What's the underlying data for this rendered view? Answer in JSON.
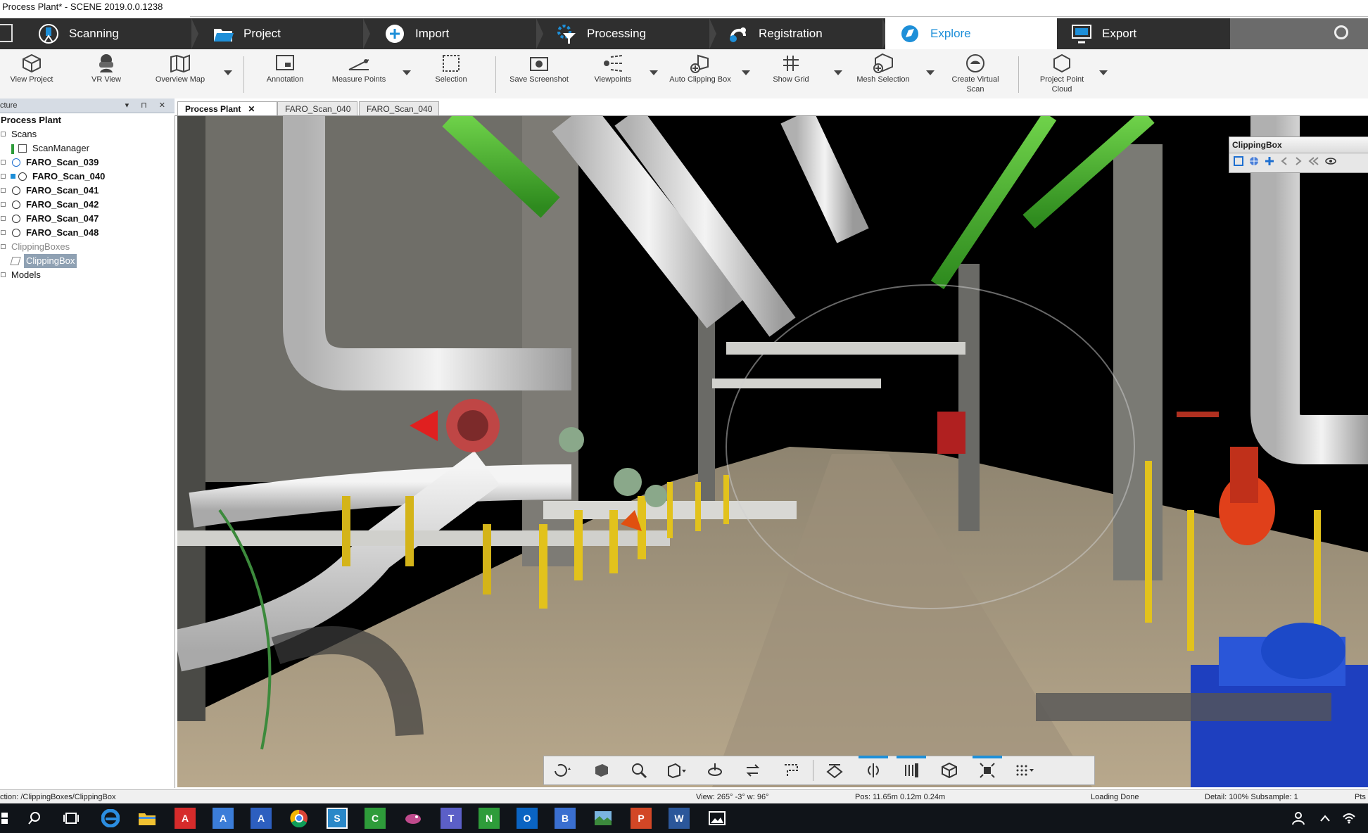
{
  "window": {
    "title": "Process Plant* - SCENE 2019.0.0.1238"
  },
  "main_tabs": [
    {
      "label": "Scanning",
      "icon": "scanner-icon"
    },
    {
      "label": "Project",
      "icon": "folder-icon"
    },
    {
      "label": "Import",
      "icon": "import-icon"
    },
    {
      "label": "Processing",
      "icon": "processing-icon"
    },
    {
      "label": "Registration",
      "icon": "registration-icon"
    },
    {
      "label": "Explore",
      "icon": "explore-icon"
    },
    {
      "label": "Export",
      "icon": "export-icon"
    }
  ],
  "ribbon": {
    "view_project": "View Project",
    "vr_view": "VR View",
    "overview_map": "Overview Map",
    "annotation": "Annotation",
    "measure_points": "Measure Points",
    "selection": "Selection",
    "save_screenshot": "Save Screenshot",
    "viewpoints": "Viewpoints",
    "auto_clipping_box": "Auto Clipping Box",
    "show_grid": "Show Grid",
    "mesh_selection": "Mesh Selection",
    "create_virtual_scan_1": "Create Virtual",
    "create_virtual_scan_2": "Scan",
    "project_point_cloud_1": "Project Point",
    "project_point_cloud_2": "Cloud"
  },
  "panel": {
    "title": "cture",
    "tree": {
      "root": "Process Plant",
      "scans": "Scans",
      "scan_manager": "ScanManager",
      "items": [
        "FARO_Scan_039",
        "FARO_Scan_040",
        "FARO_Scan_041",
        "FARO_Scan_042",
        "FARO_Scan_047",
        "FARO_Scan_048"
      ],
      "clipping_boxes": "ClippingBoxes",
      "clipping_box": "ClippingBox",
      "models": "Models"
    }
  },
  "doc_tabs": [
    "Process Plant",
    "FARO_Scan_040",
    "FARO_Scan_040"
  ],
  "clipping_window": {
    "title": "ClippingBox"
  },
  "status": {
    "selection": "ction: /ClippingBoxes/ClippingBox",
    "view": "View: 265° -3° w: 96°",
    "pos": "Pos: 11.65m 0.12m 0.24m",
    "state": "Loading Done",
    "detail": "Detail: 100%  Subsample:  1",
    "pts": "Pts"
  },
  "colors": {
    "accent": "#1e8fd8",
    "tabbar": "#2f2f2f",
    "pipe_green": "#4caf2a",
    "pipe_white": "#e8e8e8"
  }
}
